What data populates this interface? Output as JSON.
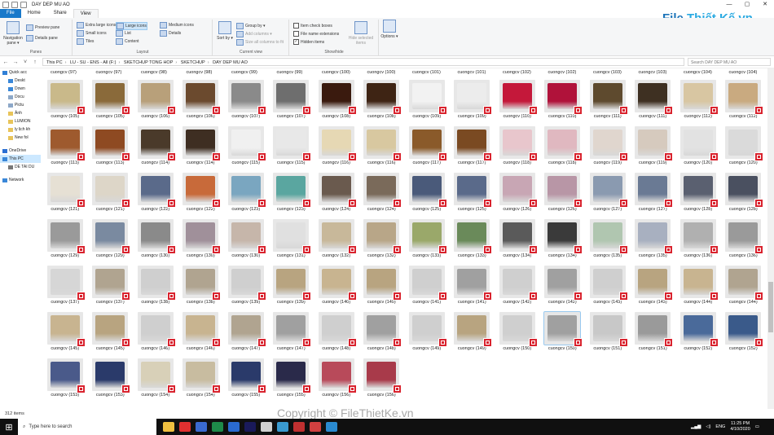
{
  "window": {
    "title": "DAY DEP MU AO",
    "controls": [
      "—",
      "▢",
      "✕"
    ]
  },
  "ribbon_tabs": [
    "File",
    "Home",
    "Share",
    "View"
  ],
  "ribbon": {
    "panes": {
      "navigation_pane": "Navigation pane ▾",
      "preview_pane": "Preview pane",
      "details_pane": "Details pane",
      "label": "Panes"
    },
    "layout": {
      "items": [
        "Extra large icons",
        "Large icons",
        "Medium icons",
        "Small icons",
        "List",
        "Details",
        "Tiles",
        "Content"
      ],
      "selected": "Large icons",
      "label": "Layout"
    },
    "current_view": {
      "sort_by": "Sort by ▾",
      "group_by": "Group by ▾",
      "add_columns": "Add columns ▾",
      "size_columns": "Size all columns to fit",
      "label": "Current view"
    },
    "show_hide": {
      "item_check_boxes": "Item check boxes",
      "file_name_extensions": "File name extensions",
      "hidden_items": "Hidden items",
      "hide_selected": "Hide selected items",
      "label": "Show/hide"
    },
    "options": "Options ▾"
  },
  "address": {
    "segments": [
      "This PC",
      "LU - SU - ENS - All (F:)",
      "SKETCHUP TONG HOP",
      "SKETCHUP",
      "DAY DEP MU AO"
    ],
    "search_placeholder": "Search DAY DEP MU AO"
  },
  "nav_pane": [
    {
      "label": "Quick acc",
      "color": "#2f7fd6"
    },
    {
      "label": "Deskt",
      "color": "#3a87d8"
    },
    {
      "label": "Down",
      "color": "#3a87d8"
    },
    {
      "label": "Docu",
      "color": "#8da8c8"
    },
    {
      "label": "Pictu",
      "color": "#8da8c8"
    },
    {
      "label": "Ảnh",
      "color": "#e8c45a"
    },
    {
      "label": "LUMION",
      "color": "#e8c45a"
    },
    {
      "label": "ly lịch kh",
      "color": "#e8c45a"
    },
    {
      "label": "New fol",
      "color": "#e8c45a"
    },
    {
      "label": "OneDrive",
      "color": "#2a6fd3"
    },
    {
      "label": "This PC",
      "color": "#3a87d8"
    },
    {
      "label": "DE TAI DU",
      "color": "#777777"
    },
    {
      "label": "Network",
      "color": "#3a87d8"
    }
  ],
  "top_partial_labels": [
    "cuongcv (97)",
    "cuongcv (97)",
    "cuongcv (98)",
    "cuongcv (98)",
    "cuongcv (99)",
    "cuongcv (99)",
    "cuongcv (100)",
    "cuongcv (100)",
    "cuongcv (101)",
    "cuongcv (101)",
    "cuongcv (102)",
    "cuongcv (102)",
    "cuongcv (103)",
    "cuongcv (103)",
    "cuongcv (104)",
    "cuongcv (104)"
  ],
  "files": [
    {
      "name": "cuongcv (105)",
      "c": "#c9b98a"
    },
    {
      "name": "cuongcv (105)",
      "c": "#8a6a3a"
    },
    {
      "name": "cuongcv (106)",
      "c": "#b8a07a"
    },
    {
      "name": "cuongcv (106)",
      "c": "#6b4a2e"
    },
    {
      "name": "cuongcv (107)",
      "c": "#8a8a8a"
    },
    {
      "name": "cuongcv (107)",
      "c": "#6e6e6e"
    },
    {
      "name": "cuongcv (108)",
      "c": "#3a1a0e"
    },
    {
      "name": "cuongcv (108)",
      "c": "#3e2414"
    },
    {
      "name": "cuongcv (109)",
      "c": "#f2f2f2"
    },
    {
      "name": "cuongcv (109)",
      "c": "#ececec"
    },
    {
      "name": "cuongcv (110)",
      "c": "#c4183a"
    },
    {
      "name": "cuongcv (110)",
      "c": "#b0123a"
    },
    {
      "name": "cuongcv (111)",
      "c": "#5e4a2e"
    },
    {
      "name": "cuongcv (111)",
      "c": "#3e3022"
    },
    {
      "name": "cuongcv (112)",
      "c": "#d8c6a2"
    },
    {
      "name": "cuongcv (112)",
      "c": "#c9aa80"
    },
    {
      "name": "cuongcv (113)",
      "c": "#9e5a2e"
    },
    {
      "name": "cuongcv (113)",
      "c": "#8e4a22"
    },
    {
      "name": "cuongcv (114)",
      "c": "#4a3a2a"
    },
    {
      "name": "cuongcv (114)",
      "c": "#3e2e22"
    },
    {
      "name": "cuongcv (115)",
      "c": "#f0f0f0"
    },
    {
      "name": "cuongcv (115)",
      "c": "#e8e8e8"
    },
    {
      "name": "cuongcv (116)",
      "c": "#e6d8b4"
    },
    {
      "name": "cuongcv (116)",
      "c": "#d8c8a0"
    },
    {
      "name": "cuongcv (117)",
      "c": "#8a5a2a"
    },
    {
      "name": "cuongcv (117)",
      "c": "#7a4a22"
    },
    {
      "name": "cuongcv (118)",
      "c": "#e8c6cc"
    },
    {
      "name": "cuongcv (118)",
      "c": "#e0b8c0"
    },
    {
      "name": "cuongcv (119)",
      "c": "#e0d6ce"
    },
    {
      "name": "cuongcv (119)",
      "c": "#d6cabe"
    },
    {
      "name": "cuongcv (120)",
      "c": "#e2e2e2"
    },
    {
      "name": "cuongcv (120)",
      "c": "#dadada"
    },
    {
      "name": "cuongcv (121)",
      "c": "#e6e0d4"
    },
    {
      "name": "cuongcv (121)",
      "c": "#ddd6c8"
    },
    {
      "name": "cuongcv (122)",
      "c": "#5a6a8a"
    },
    {
      "name": "cuongcv (122)",
      "c": "#c86a3a"
    },
    {
      "name": "cuongcv (123)",
      "c": "#7aa6c0"
    },
    {
      "name": "cuongcv (123)",
      "c": "#5aa6a0"
    },
    {
      "name": "cuongcv (124)",
      "c": "#6a5a4e"
    },
    {
      "name": "cuongcv (124)",
      "c": "#7a6a5a"
    },
    {
      "name": "cuongcv (125)",
      "c": "#4a5a7a"
    },
    {
      "name": "cuongcv (125)",
      "c": "#5a6a8a"
    },
    {
      "name": "cuongcv (126)",
      "c": "#c8a6b4"
    },
    {
      "name": "cuongcv (126)",
      "c": "#b896a6"
    },
    {
      "name": "cuongcv (127)",
      "c": "#8a9ab0"
    },
    {
      "name": "cuongcv (127)",
      "c": "#6a7a94"
    },
    {
      "name": "cuongcv (128)",
      "c": "#5a6070"
    },
    {
      "name": "cuongcv (128)",
      "c": "#4a5060"
    },
    {
      "name": "cuongcv (129)",
      "c": "#9a9a9a"
    },
    {
      "name": "cuongcv (129)",
      "c": "#7a8aa0"
    },
    {
      "name": "cuongcv (130)",
      "c": "#8a8a8a"
    },
    {
      "name": "cuongcv (130)",
      "c": "#a0909a"
    },
    {
      "name": "cuongcv (130)",
      "c": "#c6b6aa"
    },
    {
      "name": "cuongcv (131)",
      "c": "#e0e0e0"
    },
    {
      "name": "cuongcv (132)",
      "c": "#c8b89a"
    },
    {
      "name": "cuongcv (132)",
      "c": "#b8a688"
    },
    {
      "name": "cuongcv (133)",
      "c": "#9aa86a"
    },
    {
      "name": "cuongcv (133)",
      "c": "#6a8a5a"
    },
    {
      "name": "cuongcv (134)",
      "c": "#5a5a5a"
    },
    {
      "name": "cuongcv (134)",
      "c": "#3a3a3a"
    },
    {
      "name": "cuongcv (135)",
      "c": "#b0c6b0"
    },
    {
      "name": "cuongcv (135)",
      "c": "#a8b0c0"
    },
    {
      "name": "cuongcv (136)",
      "c": "#b0b0b0"
    },
    {
      "name": "cuongcv (136)",
      "c": "#9a9a9a"
    },
    {
      "name": "cuongcv (137)",
      "c": "#d6d6d6"
    },
    {
      "name": "cuongcv (137)",
      "c": "#b0a490"
    },
    {
      "name": "cuongcv (138)",
      "c": "#cfcfcf"
    },
    {
      "name": "cuongcv (138)",
      "c": "#b0a490"
    },
    {
      "name": "cuongcv (139)",
      "c": "#cfcfcf"
    },
    {
      "name": "cuongcv (139)",
      "c": "#b8a480"
    },
    {
      "name": "cuongcv (140)",
      "c": "#c8b490"
    },
    {
      "name": "cuongcv (140)",
      "c": "#b8a480"
    },
    {
      "name": "cuongcv (141)",
      "c": "#cfcfcf"
    },
    {
      "name": "cuongcv (141)",
      "c": "#a0a0a0"
    },
    {
      "name": "cuongcv (142)",
      "c": "#cfcfcf"
    },
    {
      "name": "cuongcv (142)",
      "c": "#a0a0a0"
    },
    {
      "name": "cuongcv (143)",
      "c": "#cfcfcf"
    },
    {
      "name": "cuongcv (143)",
      "c": "#b8a480"
    },
    {
      "name": "cuongcv (144)",
      "c": "#c8b490"
    },
    {
      "name": "cuongcv (144)",
      "c": "#b0a490"
    },
    {
      "name": "cuongcv (145)",
      "c": "#c8b490"
    },
    {
      "name": "cuongcv (145)",
      "c": "#b8a480"
    },
    {
      "name": "cuongcv (146)",
      "c": "#cfcfcf"
    },
    {
      "name": "cuongcv (146)",
      "c": "#c8b490"
    },
    {
      "name": "cuongcv (147)",
      "c": "#b0a490"
    },
    {
      "name": "cuongcv (147)",
      "c": "#a0a0a0"
    },
    {
      "name": "cuongcv (148)",
      "c": "#cfcfcf"
    },
    {
      "name": "cuongcv (148)",
      "c": "#a0a0a0"
    },
    {
      "name": "cuongcv (149)",
      "c": "#cfcfcf"
    },
    {
      "name": "cuongcv (149)",
      "c": "#b8a480"
    },
    {
      "name": "cuongcv (150)",
      "c": "#cfcfcf"
    },
    {
      "name": "cuongcv (150)",
      "c": "#a0a0a0",
      "selected": true
    },
    {
      "name": "cuongcv (151)",
      "c": "#c8c8c8"
    },
    {
      "name": "cuongcv (151)",
      "c": "#9a9a9a"
    },
    {
      "name": "cuongcv (152)",
      "c": "#4a6a9a"
    },
    {
      "name": "cuongcv (152)",
      "c": "#3a5a8a"
    },
    {
      "name": "cuongcv (153)",
      "c": "#4a5a8a"
    },
    {
      "name": "cuongcv (153)",
      "c": "#2a3a6a"
    },
    {
      "name": "cuongcv (154)",
      "c": "#d8d0b8"
    },
    {
      "name": "cuongcv (154)",
      "c": "#c8bca0"
    },
    {
      "name": "cuongcv (155)",
      "c": "#2a3a6a"
    },
    {
      "name": "cuongcv (155)",
      "c": "#2a2a4a"
    },
    {
      "name": "cuongcv (156)",
      "c": "#b84a5a"
    },
    {
      "name": "cuongcv (156)",
      "c": "#a83a4a"
    }
  ],
  "status": {
    "item_count": "312 items"
  },
  "watermark": "Copyright © FileThietKe.vn",
  "logo": {
    "prefix": "File",
    "suffix": " Thiết Kế.vn"
  },
  "taskbar": {
    "search_placeholder": "Type here to search",
    "apps": [
      "#f0c040",
      "#e03030",
      "#3a6ad0",
      "#1e8a4a",
      "#2a6ad0",
      "#1a1a5a",
      "#d0d0d0",
      "#3a9ad0",
      "#c03030",
      "#d04040",
      "#2a8ad0"
    ],
    "lang": "ENG",
    "time": "11:25 PM",
    "date": "4/10/2020"
  }
}
